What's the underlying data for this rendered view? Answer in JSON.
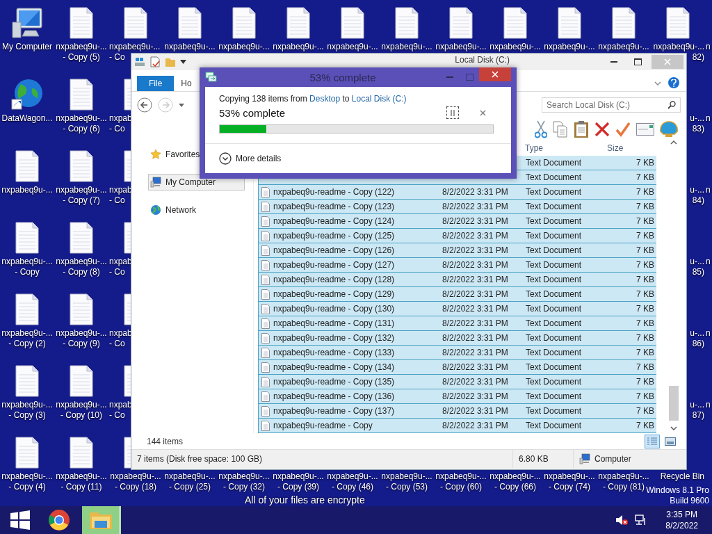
{
  "wallpaper_text": "All of your files are encrypte",
  "desktop_rows": [
    {
      "cells": [
        {
          "kind": "computer",
          "lines": [
            "My Computer"
          ]
        },
        {
          "kind": "document",
          "lines": [
            "nxpabeq9u-...",
            "- Copy (5)"
          ]
        },
        {
          "kind": "document",
          "lines": [
            "nxpabeq9u-...",
            "- Co"
          ]
        },
        {
          "kind": "document",
          "lines": [
            "nxpabeq9u-..."
          ]
        },
        {
          "kind": "document",
          "lines": [
            "nxpabeq9u-..."
          ]
        },
        {
          "kind": "document",
          "lines": [
            "nxpabeq9u-..."
          ]
        },
        {
          "kind": "document",
          "lines": [
            "nxpabeq9u-..."
          ]
        },
        {
          "kind": "document",
          "lines": [
            "nxpabeq9u-..."
          ]
        },
        {
          "kind": "document",
          "lines": [
            "nxpabeq9u-..."
          ]
        },
        {
          "kind": "document",
          "lines": [
            "nxpabeq9u-..."
          ]
        },
        {
          "kind": "document",
          "lines": [
            "nxpabeq9u-..."
          ]
        },
        {
          "kind": "document",
          "lines": [
            "nxpabeq9u-..."
          ]
        },
        {
          "kind": "document",
          "lines": [
            "nxpabeq9u-...",
            "82)"
          ]
        },
        {
          "lines": [
            "n"
          ]
        }
      ]
    },
    {
      "cells": [
        {
          "kind": "globe",
          "lines": [
            "DataWagon..."
          ]
        },
        {
          "kind": "document",
          "lines": [
            "nxpabeq9u-...",
            "- Copy (6)"
          ]
        },
        {
          "kind": "document",
          "lines": [
            "nxpab",
            "- Co"
          ]
        }
      ],
      "right_cells": [
        {
          "lines": [
            "u-...",
            "83)"
          ]
        },
        {
          "lines": [
            "n"
          ]
        }
      ]
    },
    {
      "cells": [
        {
          "kind": "document",
          "lines": [
            "nxpabeq9u-..."
          ]
        },
        {
          "kind": "document",
          "lines": [
            "nxpabeq9u-...",
            "- Copy (7)"
          ]
        },
        {
          "kind": "document",
          "lines": [
            "nxpab",
            "- Co"
          ]
        }
      ],
      "right_cells": [
        {
          "lines": [
            "u-...",
            "84)"
          ]
        },
        {
          "lines": [
            "n"
          ]
        }
      ]
    },
    {
      "cells": [
        {
          "kind": "document",
          "lines": [
            "nxpabeq9u-...",
            "- Copy"
          ]
        },
        {
          "kind": "document",
          "lines": [
            "nxpabeq9u-...",
            "- Copy (8)"
          ]
        },
        {
          "kind": "document",
          "lines": [
            "nxpab",
            "- Co"
          ]
        }
      ],
      "right_cells": [
        {
          "lines": [
            "u-...",
            "85)"
          ]
        },
        {
          "lines": [
            "n"
          ]
        }
      ]
    },
    {
      "cells": [
        {
          "kind": "document",
          "lines": [
            "nxpabeq9u-...",
            "- Copy (2)"
          ]
        },
        {
          "kind": "document",
          "lines": [
            "nxpabeq9u-...",
            "- Copy (9)"
          ]
        },
        {
          "kind": "document",
          "lines": [
            "nxpab",
            "- Co"
          ]
        }
      ],
      "right_cells": [
        {
          "lines": [
            "u-...",
            "86)"
          ]
        },
        {
          "lines": [
            "n"
          ]
        }
      ]
    },
    {
      "cells": [
        {
          "kind": "document",
          "lines": [
            "nxpabeq9u-...",
            "- Copy (3)"
          ]
        },
        {
          "kind": "document",
          "lines": [
            "nxpabeq9u-...",
            "- Copy (10)"
          ]
        },
        {
          "kind": "document",
          "lines": [
            "nxpab",
            "- Co"
          ]
        }
      ],
      "right_cells": [
        {
          "lines": [
            "u-...",
            "87)"
          ]
        },
        {
          "lines": [
            "n"
          ]
        }
      ]
    },
    {
      "cells": [
        {
          "kind": "document",
          "lines": [
            "nxpabeq9u-...",
            "- Copy (4)"
          ]
        },
        {
          "kind": "document",
          "lines": [
            "nxpabeq9u-...",
            "- Copy (11)"
          ]
        },
        {
          "kind": "document",
          "lines": [
            "nxpabeq9u-...",
            "- Copy (18)"
          ]
        },
        {
          "lines": [
            "nxpabeq9u-...",
            "- Copy (25)"
          ]
        },
        {
          "lines": [
            "nxpabeq9u-...",
            "- Copy (32)"
          ]
        },
        {
          "lines": [
            "nxpabeq9u-...",
            "- Copy (39)"
          ]
        },
        {
          "lines": [
            "nxpabeq9u-...",
            "- Copy (46)"
          ]
        },
        {
          "lines": [
            "nxpabeq9u-...",
            "- Copy (53)"
          ]
        },
        {
          "lines": [
            "nxpabeq9u-...",
            "- Copy (60)"
          ]
        },
        {
          "lines": [
            "nxpabeq9u-...",
            "- Copy (66)"
          ]
        },
        {
          "lines": [
            "nxpabeq9u-...",
            "- Copy (74)"
          ]
        },
        {
          "lines": [
            "nxpabeq9u-...",
            "- Copy (81)"
          ]
        },
        {
          "lines": [
            "Recycle Bin"
          ]
        }
      ]
    }
  ],
  "os_watermark": [
    "Windows 8.1 Pro",
    "Build 9600"
  ],
  "explorer": {
    "title": "Local Disk (C:)",
    "ribbon_tabs": [
      {
        "label": "File",
        "kind": "file"
      },
      {
        "label": "Ho",
        "kind": "tab"
      }
    ],
    "search": {
      "placeholder": "Search Local Disk (C:)"
    },
    "nav": [
      {
        "label": "Favorites",
        "kind": "star",
        "selected": false
      },
      {
        "label": "My Computer",
        "kind": "computer",
        "selected": true
      },
      {
        "label": "Network",
        "kind": "network",
        "selected": false
      }
    ],
    "columns": [
      "Type",
      "Size"
    ],
    "rows": [
      {
        "type": "Text Document",
        "size": "7 KB",
        "selected": true
      },
      {
        "type": "Text Document",
        "size": "7 KB",
        "selected": true
      },
      {
        "name": "nxpabeq9u-readme - Copy (122)",
        "date": "8/2/2022 3:31 PM",
        "type": "Text Document",
        "size": "7 KB",
        "selected": true
      },
      {
        "name": "nxpabeq9u-readme - Copy (123)",
        "date": "8/2/2022 3:31 PM",
        "type": "Text Document",
        "size": "7 KB",
        "selected": true
      },
      {
        "name": "nxpabeq9u-readme - Copy (124)",
        "date": "8/2/2022 3:31 PM",
        "type": "Text Document",
        "size": "7 KB",
        "selected": true
      },
      {
        "name": "nxpabeq9u-readme - Copy (125)",
        "date": "8/2/2022 3:31 PM",
        "type": "Text Document",
        "size": "7 KB",
        "selected": true
      },
      {
        "name": "nxpabeq9u-readme - Copy (126)",
        "date": "8/2/2022 3:31 PM",
        "type": "Text Document",
        "size": "7 KB",
        "selected": true
      },
      {
        "name": "nxpabeq9u-readme - Copy (127)",
        "date": "8/2/2022 3:31 PM",
        "type": "Text Document",
        "size": "7 KB",
        "selected": true
      },
      {
        "name": "nxpabeq9u-readme - Copy (128)",
        "date": "8/2/2022 3:31 PM",
        "type": "Text Document",
        "size": "7 KB",
        "selected": true
      },
      {
        "name": "nxpabeq9u-readme - Copy (129)",
        "date": "8/2/2022 3:31 PM",
        "type": "Text Document",
        "size": "7 KB",
        "selected": true
      },
      {
        "name": "nxpabeq9u-readme - Copy (130)",
        "date": "8/2/2022 3:31 PM",
        "type": "Text Document",
        "size": "7 KB",
        "selected": true
      },
      {
        "name": "nxpabeq9u-readme - Copy (131)",
        "date": "8/2/2022 3:31 PM",
        "type": "Text Document",
        "size": "7 KB",
        "selected": true
      },
      {
        "name": "nxpabeq9u-readme - Copy (132)",
        "date": "8/2/2022 3:31 PM",
        "type": "Text Document",
        "size": "7 KB",
        "selected": true
      },
      {
        "name": "nxpabeq9u-readme - Copy (133)",
        "date": "8/2/2022 3:31 PM",
        "type": "Text Document",
        "size": "7 KB",
        "selected": true
      },
      {
        "name": "nxpabeq9u-readme - Copy (134)",
        "date": "8/2/2022 3:31 PM",
        "type": "Text Document",
        "size": "7 KB",
        "selected": true
      },
      {
        "name": "nxpabeq9u-readme - Copy (135)",
        "date": "8/2/2022 3:31 PM",
        "type": "Text Document",
        "size": "7 KB",
        "selected": true
      },
      {
        "name": "nxpabeq9u-readme - Copy (136)",
        "date": "8/2/2022 3:31 PM",
        "type": "Text Document",
        "size": "7 KB",
        "selected": true
      },
      {
        "name": "nxpabeq9u-readme - Copy (137)",
        "date": "8/2/2022 3:31 PM",
        "type": "Text Document",
        "size": "7 KB",
        "selected": true
      },
      {
        "name": "nxpabeq9u-readme - Copy",
        "date": "8/2/2022 3:31 PM",
        "type": "Text Document",
        "size": "7 KB",
        "selected": true
      }
    ],
    "item_count": "144 items",
    "status": {
      "selection": "7 items (Disk free space: 100 GB)",
      "size": "6.80 KB",
      "location": "Computer"
    }
  },
  "dialog": {
    "title": "53% complete",
    "prefix": "Copying 138 items from",
    "source": "Desktop",
    "middle": "to",
    "destination": "Local Disk (C:)",
    "status": "53% complete",
    "level": 0.17,
    "details": "More details"
  },
  "taskbar": {
    "items": [
      {
        "kind": "start",
        "selected": false
      },
      {
        "kind": "browser",
        "selected": false
      },
      {
        "kind": "explorer",
        "selected": true
      }
    ],
    "time": "3:35 PM",
    "date": "8/2/2022"
  }
}
